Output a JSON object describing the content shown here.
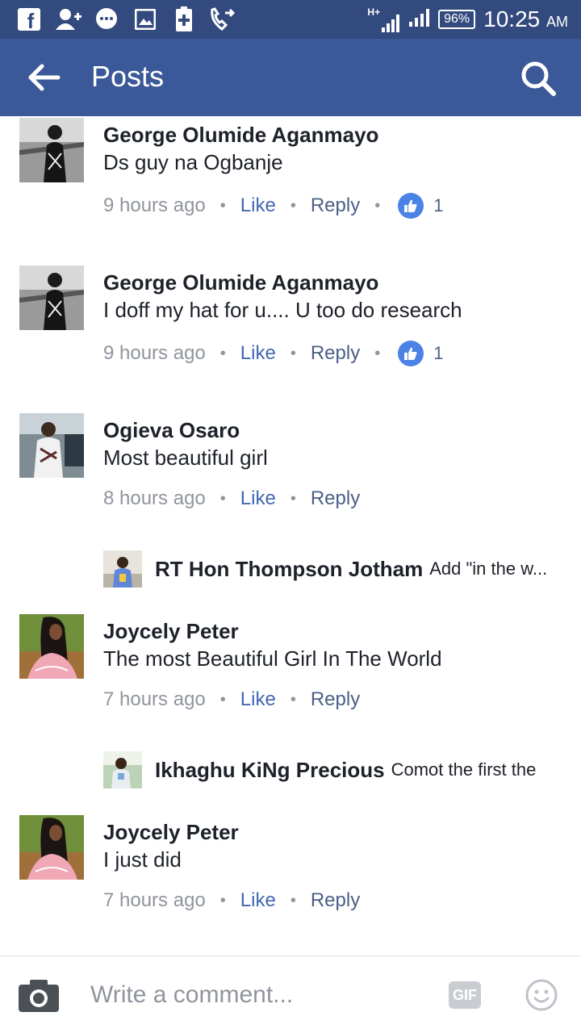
{
  "status_bar": {
    "network_type": "H+",
    "battery_percent": "96%",
    "time": "10:25",
    "ampm": "AM",
    "notification_icons": [
      "facebook-icon",
      "add-friend-icon",
      "messenger-icon",
      "gallery-icon",
      "battery-plus-icon",
      "call-forward-icon"
    ]
  },
  "app_bar": {
    "title": "Posts",
    "background": "#3b5998"
  },
  "comments": [
    {
      "author": "George Olumide Aganmayo",
      "text": "Ds guy na Ogbanje",
      "time": "9 hours ago",
      "like_label": "Like",
      "reply_label": "Reply",
      "reaction_count": "1"
    },
    {
      "author": "George Olumide Aganmayo",
      "text": "I doff my hat for u.... U too do research",
      "time": "9 hours ago",
      "like_label": "Like",
      "reply_label": "Reply",
      "reaction_count": "1"
    },
    {
      "author": "Ogieva Osaro",
      "text": "Most beautiful girl",
      "time": "8 hours ago",
      "like_label": "Like",
      "reply_label": "Reply",
      "reply_preview": {
        "author": "RT Hon Thompson Jotham",
        "text": "Add \"in the w..."
      }
    },
    {
      "author": "Joycely Peter",
      "text": "The most Beautiful Girl In The World",
      "time": "7 hours ago",
      "like_label": "Like",
      "reply_label": "Reply",
      "reply_preview": {
        "author": "Ikhaghu KiNg Precious",
        "text": "Comot the first the"
      }
    },
    {
      "author": "Joycely Peter",
      "text": "I just did",
      "time": "7 hours ago",
      "like_label": "Like",
      "reply_label": "Reply"
    }
  ],
  "composer": {
    "placeholder": "Write a comment...",
    "gif_label": "GIF"
  },
  "colors": {
    "status_bar": "#334a7e",
    "link_blue": "#4267b2",
    "reply_gray_blue": "#4b5f86",
    "meta_gray": "#90949c",
    "like_badge": "#4a82e6"
  }
}
